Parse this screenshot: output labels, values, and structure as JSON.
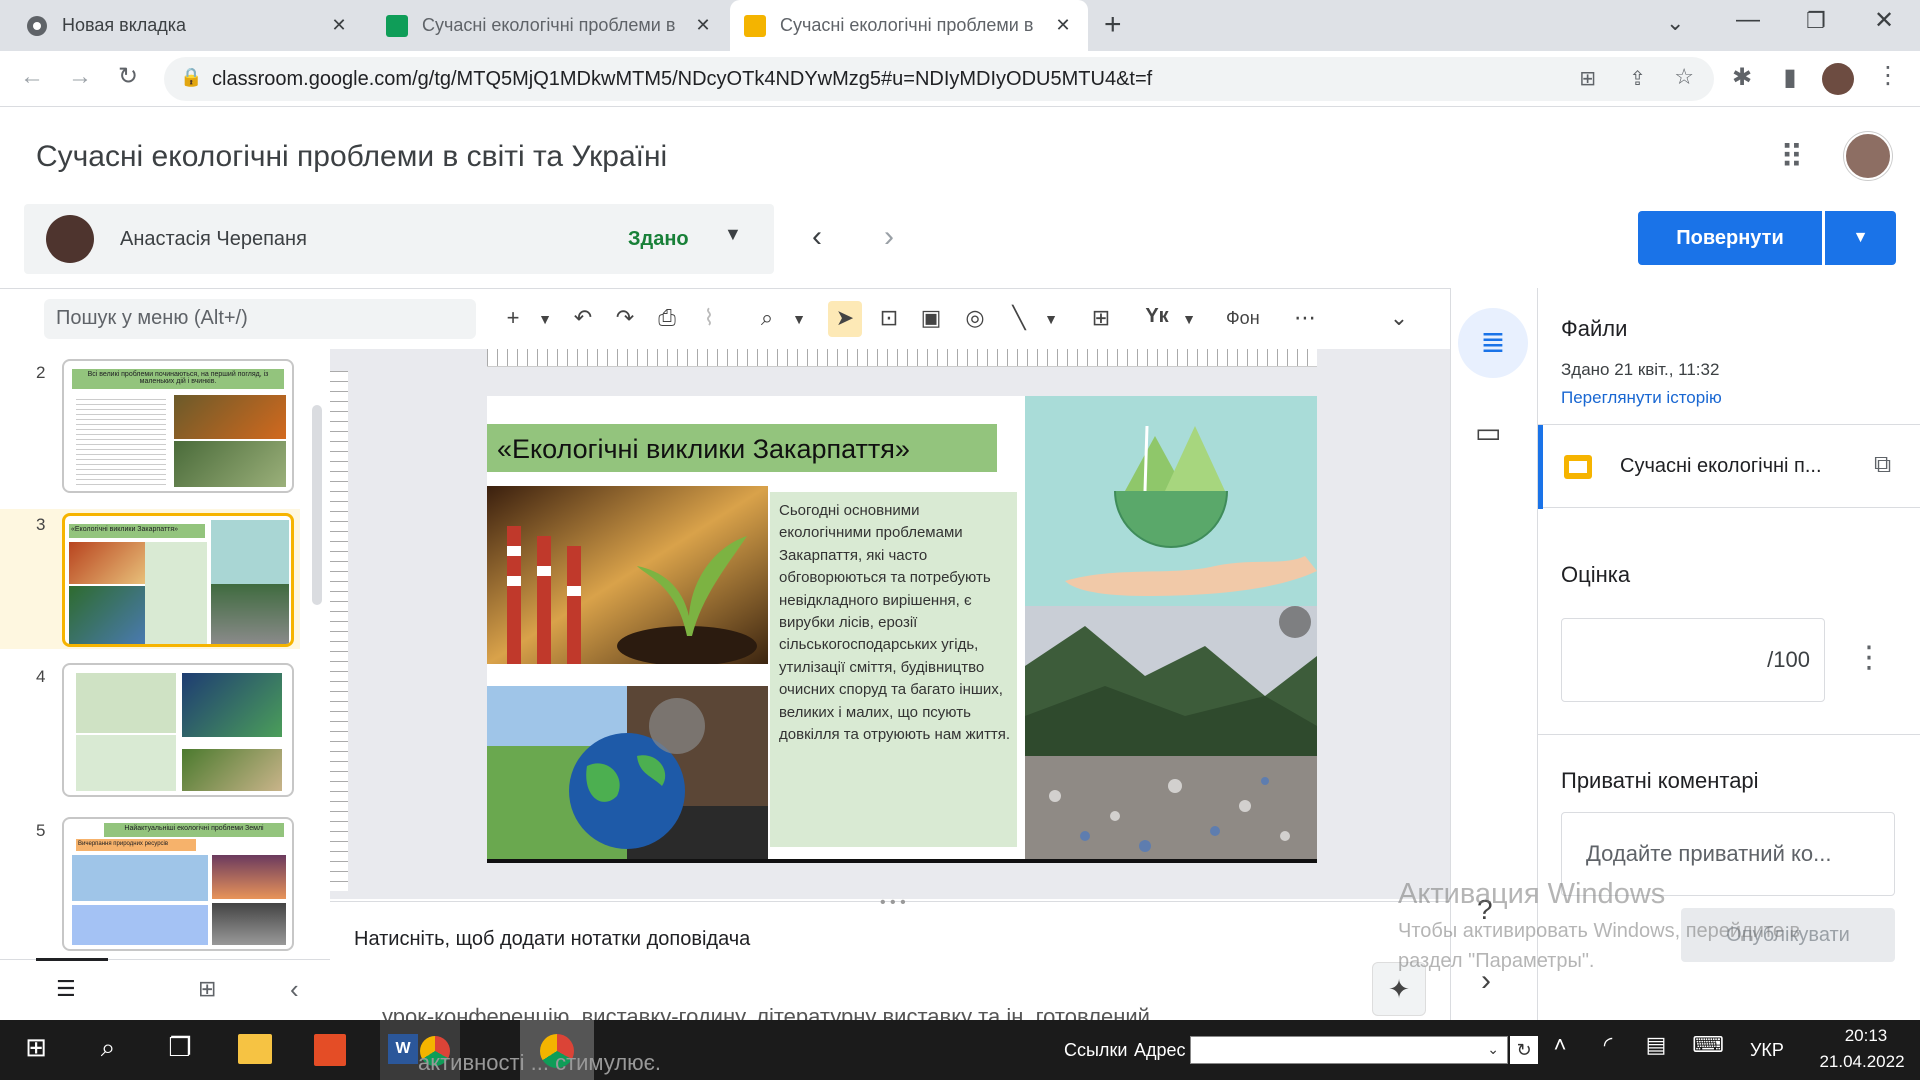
{
  "browser": {
    "tabs": [
      {
        "title": "Новая вкладка"
      },
      {
        "title": "Сучасні екологічні проблеми в"
      },
      {
        "title": "Сучасні екологічні проблеми в"
      }
    ],
    "url": "classroom.google.com/g/tg/MTQ5MjQ1MDkwMTM5/NDcyOTk4NDYwMzg5#u=NDIyMDIyODU5MTU4&t=f"
  },
  "assignment": {
    "title": "Сучасні екологічні проблеми в світі та Україні",
    "student_name": "Анастасія Черепаня",
    "status": "Здано",
    "return_button": "Повернути"
  },
  "slides_toolbar": {
    "menu_search_placeholder": "Пошук у меню (Alt+/)",
    "background_label": "Фон"
  },
  "filmstrip": [
    {
      "number": "2",
      "title": "Всі великі проблеми починаються, на перший погляд, із маленьких дій і вчинків."
    },
    {
      "number": "3",
      "title": "«Екологічні виклики Закарпаття»"
    },
    {
      "number": "4",
      "title": ""
    },
    {
      "number": "5",
      "title": "Найактуальніші екологічні проблеми Землі",
      "subtitle": "Вичерпання природних ресурсів"
    }
  ],
  "slide": {
    "title": "«Екологічні виклики Закарпаття»",
    "body": "Сьогодні основними екологічними проблемами Закарпаття, які часто обговорюються та потребують невідкладного  вирішення, є вирубки лісів, ерозії сільськогосподарських угідь, утилізації сміття, будівництво очисних споруд та багато інших, великих і малих, що псують довкілля та отруюють нам життя."
  },
  "notes_placeholder": "Натисніть, щоб додати нотатки доповідача",
  "right_panel": {
    "files_heading": "Файли",
    "submitted_time": "Здано 21 квіт., 11:32",
    "history_link": "Переглянути історію",
    "file_name": "Сучасні екологічні п...",
    "grade_heading": "Оцінка",
    "grade_max": "/100",
    "comments_heading": "Приватні коментарі",
    "comment_placeholder": "Додайте приватний ко...",
    "post_button": "Опублікувати"
  },
  "windows_activation": {
    "title": "Активация Windows",
    "text": "Чтобы активировать Windows, перейдите в раздел \"Параметры\"."
  },
  "background_doc_text": "урок-конференцію, виставку-годину, літературну виставку та ін. готовлений ... ",
  "background_doc_text2": "активності ... стимулює.",
  "taskbar": {
    "links_label": "Ссылки",
    "address_label": "Адрес",
    "language": "УКР",
    "time": "20:13",
    "date": "21.04.2022"
  },
  "colors": {
    "accent": "#1a73e8",
    "status_green": "#188038",
    "slide_green": "#93c47d",
    "slide_panel": "#d9ead3",
    "selected_thumb": "#f6b400"
  }
}
